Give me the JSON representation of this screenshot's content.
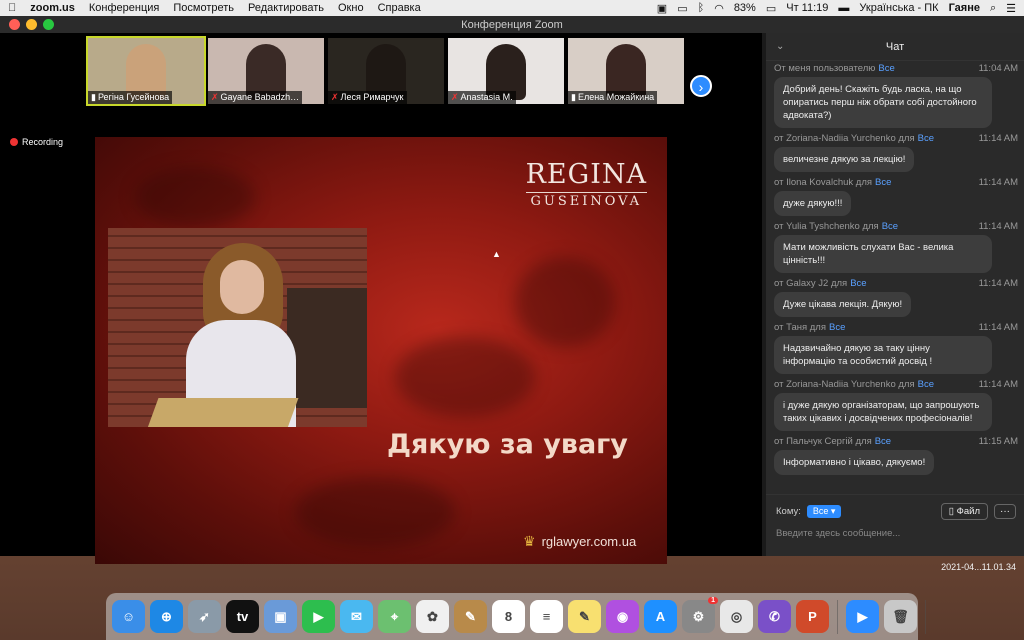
{
  "menubar": {
    "app": "zoom.us",
    "menus": [
      "Конференция",
      "Посмотреть",
      "Редактировать",
      "Окно",
      "Справка"
    ],
    "battery": "83%",
    "clock": "Чт 11:19",
    "input_source": "Українська - ПК",
    "user": "Гаяне"
  },
  "window": {
    "title": "Конференция Zoom"
  },
  "participants": [
    {
      "name": "Регіна Гусейнова",
      "muted": false,
      "active": true,
      "bg": "#b8aa8a",
      "skin": "#caa27a"
    },
    {
      "name": "Gayane Babadzh…",
      "muted": true,
      "active": false,
      "bg": "#c9b8b0",
      "skin": "#3a2a26"
    },
    {
      "name": "Леся Римарчук",
      "muted": true,
      "active": false,
      "bg": "#2a2620",
      "skin": "#1e1814"
    },
    {
      "name": "Anastasia M.",
      "muted": true,
      "active": false,
      "bg": "#e8e4e2",
      "skin": "#2a201c"
    },
    {
      "name": "Елена Можайкина",
      "muted": false,
      "active": false,
      "bg": "#d8cec6",
      "skin": "#3a2622"
    }
  ],
  "recording_label": "Recording",
  "slide": {
    "brand_name": "REGINA",
    "brand_sub": "GUSEINOVA",
    "headline": "Дякую за увагу",
    "website": "rglawyer.com.ua"
  },
  "chat": {
    "title": "Чат",
    "messages": [
      {
        "from": "От меня пользователю",
        "to": "Все",
        "time": "11:04 AM",
        "text": "Добрий день! Скажіть будь ласка, на що опиратись перш ніж обрати собі достойного адвоката?)"
      },
      {
        "from": "от Zoriana-Nadiia Yurchenko для",
        "to": "Все",
        "time": "11:14 AM",
        "text": "величезне дякую за лекцію!"
      },
      {
        "from": "от Ilona Kovalchuk для",
        "to": "Все",
        "time": "11:14 AM",
        "text": "дуже дякую!!!"
      },
      {
        "from": "от Yulia Tyshchenko для",
        "to": "Все",
        "time": "11:14 AM",
        "text": "Мати можливість слухати Вас - велика цінність!!!"
      },
      {
        "from": "от Galaxy J2 для",
        "to": "Все",
        "time": "11:14 AM",
        "text": "Дуже цікава лекція. Дякую!"
      },
      {
        "from": "от Таня для",
        "to": "Все",
        "time": "11:14 AM",
        "text": "Надзвичайно дякую за таку цінну інформацію та особистий досвід !"
      },
      {
        "from": "от Zoriana-Nadiia Yurchenko для",
        "to": "Все",
        "time": "11:14 AM",
        "text": "і дуже дякую організаторам, що запрошують таких цікавих і досвідчених професіоналів!"
      },
      {
        "from": "от Пальчук Сергій для",
        "to": "Все",
        "time": "11:15 AM",
        "text": "Інформативно і цікаво, дякуємо!"
      }
    ],
    "to_label": "Кому:",
    "to_value": "Все",
    "file_button": "Файл",
    "more_button": "···",
    "input_placeholder": "Введите здесь сообщение..."
  },
  "desktop_file": "2021-04...11.01.34",
  "dock": [
    {
      "name": "finder",
      "color": "#3a8ee8",
      "glyph": "☺"
    },
    {
      "name": "safari",
      "color": "#1e88e5",
      "glyph": "⊕"
    },
    {
      "name": "launchpad",
      "color": "#8a9aa8",
      "glyph": "➶"
    },
    {
      "name": "apple-tv",
      "color": "#111111",
      "glyph": "tv"
    },
    {
      "name": "preview",
      "color": "#6a9ad8",
      "glyph": "▣"
    },
    {
      "name": "facetime",
      "color": "#2dbe4e",
      "glyph": "▶"
    },
    {
      "name": "messages",
      "color": "#4ab8f0",
      "glyph": "✉"
    },
    {
      "name": "maps",
      "color": "#6cc070",
      "glyph": "⌖"
    },
    {
      "name": "photos",
      "color": "#f0f0f0",
      "glyph": "✿"
    },
    {
      "name": "notes-brown",
      "color": "#b88a4a",
      "glyph": "✎"
    },
    {
      "name": "calendar",
      "color": "#ffffff",
      "glyph": "8"
    },
    {
      "name": "reminders",
      "color": "#ffffff",
      "glyph": "≡"
    },
    {
      "name": "notes",
      "color": "#f8e070",
      "glyph": "✎"
    },
    {
      "name": "podcasts",
      "color": "#b050e0",
      "glyph": "◉"
    },
    {
      "name": "app-store",
      "color": "#1e90ff",
      "glyph": "A"
    },
    {
      "name": "system-preferences",
      "color": "#888888",
      "glyph": "⚙",
      "badge": "1"
    },
    {
      "name": "chrome",
      "color": "#e8e8e8",
      "glyph": "◎"
    },
    {
      "name": "viber",
      "color": "#7a50c8",
      "glyph": "✆"
    },
    {
      "name": "powerpoint",
      "color": "#d04a2a",
      "glyph": "P"
    },
    {
      "name": "zoom",
      "color": "#2d8cff",
      "glyph": "▶"
    },
    {
      "name": "trash",
      "color": "#c8c8c8",
      "glyph": "🗑"
    }
  ],
  "dock_separators_after": [
    18,
    20
  ]
}
